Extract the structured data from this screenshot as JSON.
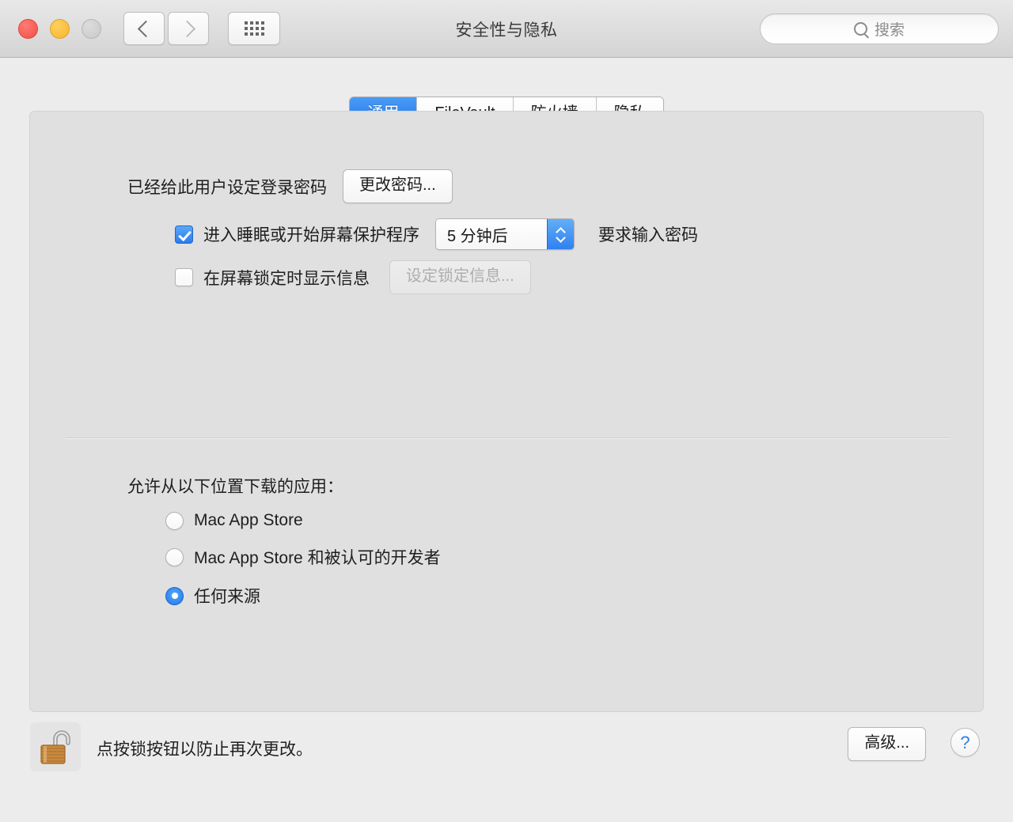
{
  "window": {
    "title": "安全性与隐私",
    "traffic_lights": [
      {
        "name": "close",
        "color": "#f24f46"
      },
      {
        "name": "minimize",
        "color": "#f7b52b"
      },
      {
        "name": "zoom",
        "color": "#c9c9c9"
      }
    ],
    "toolbar": {
      "back_icon": "chevron-left-icon",
      "forward_icon": "chevron-right-icon",
      "show_all_icon": "grid-icon"
    },
    "search": {
      "icon": "search-icon",
      "placeholder": "搜索",
      "value": ""
    }
  },
  "tabs": [
    {
      "label": "通用",
      "active": true
    },
    {
      "label": "FileVault",
      "active": false
    },
    {
      "label": "防火墙",
      "active": false
    },
    {
      "label": "隐私",
      "active": false
    }
  ],
  "general": {
    "password_status": "已经给此用户设定登录密码",
    "change_password_button": "更改密码...",
    "require_password": {
      "checkbox_checked": true,
      "label": "进入睡眠或开始屏幕保护程序",
      "delay_value": "5 分钟后",
      "trailing_label": "要求输入密码"
    },
    "lock_message": {
      "checkbox_checked": false,
      "label": "在屏幕锁定时显示信息",
      "set_message_button": "设定锁定信息...",
      "button_disabled": true
    }
  },
  "downloads": {
    "title": "允许从以下位置下载的应用：",
    "options": [
      {
        "label": "Mac App Store",
        "selected": false
      },
      {
        "label": "Mac App Store 和被认可的开发者",
        "selected": false
      },
      {
        "label": "任何来源",
        "selected": true
      }
    ]
  },
  "footer": {
    "lock_icon": "unlocked-padlock-icon",
    "lock_note": "点按锁按钮以防止再次更改。",
    "advanced_button": "高级...",
    "help_button": "?"
  },
  "colors": {
    "accent": "#2b7ced",
    "window_bg": "#ececec",
    "panel_bg": "#e0e0e0"
  }
}
